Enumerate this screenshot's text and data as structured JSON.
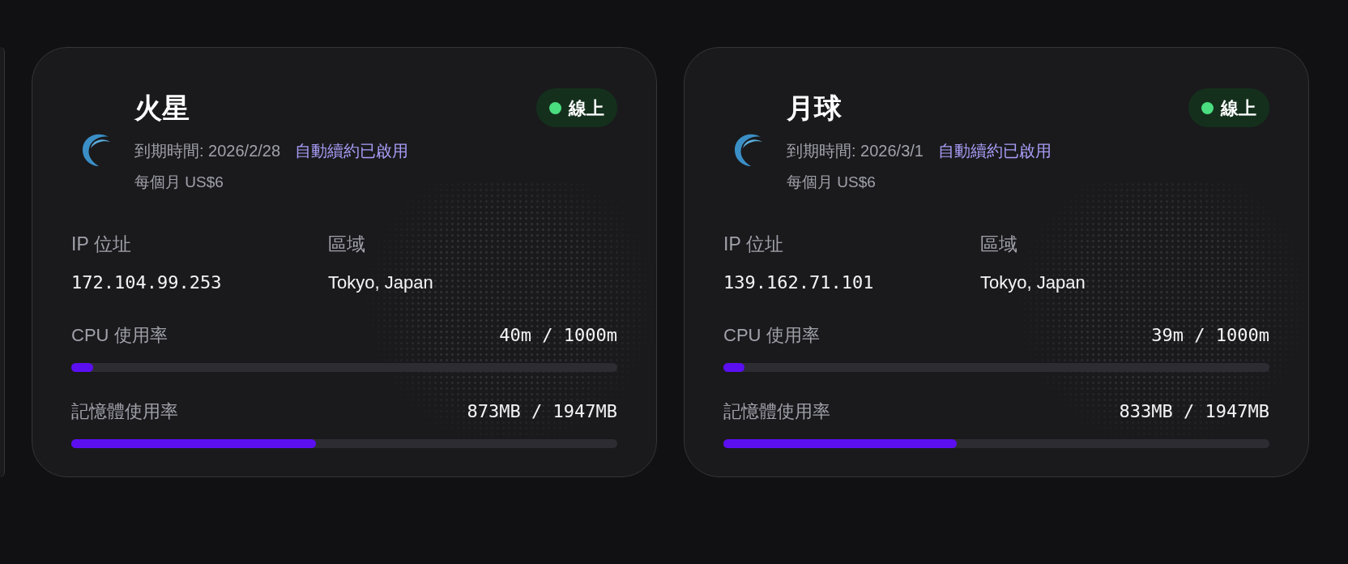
{
  "servers": [
    {
      "name": "火星",
      "status": {
        "label": "線上",
        "color": "#4ade80"
      },
      "expiry": "到期時間: 2026/2/28",
      "auto_renew": "自動續約已啟用",
      "price": "每個月 US$6",
      "ip_label": "IP 位址",
      "ip": "172.104.99.253",
      "region_label": "區域",
      "region": "Tokyo, Japan",
      "cpu": {
        "label": "CPU 使用率",
        "reading": "40m / 1000m",
        "level": 0.04
      },
      "memory": {
        "label": "記憶體使用率",
        "reading": "873MB / 1947MB",
        "level": 0.448
      }
    },
    {
      "name": "月球",
      "status": {
        "label": "線上",
        "color": "#4ade80"
      },
      "expiry": "到期時間: 2026/3/1",
      "auto_renew": "自動續約已啟用",
      "price": "每個月 US$6",
      "ip_label": "IP 位址",
      "ip": "139.162.71.101",
      "region_label": "區域",
      "region": "Tokyo, Japan",
      "cpu": {
        "label": "CPU 使用率",
        "reading": "39m / 1000m",
        "level": 0.039
      },
      "memory": {
        "label": "記憶體使用率",
        "reading": "833MB / 1947MB",
        "level": 0.428
      }
    }
  ]
}
